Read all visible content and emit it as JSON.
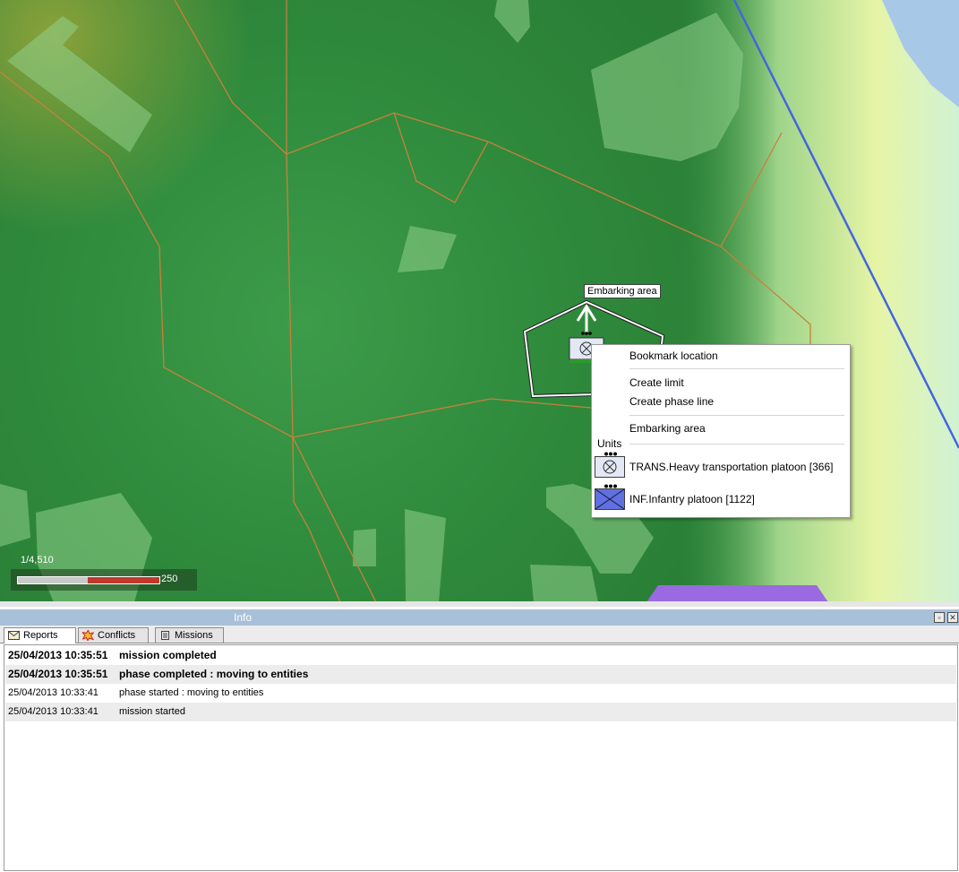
{
  "map": {
    "labels": {
      "embarking_area": "Embarking area"
    },
    "scale": {
      "ratio": "1/4,510",
      "value": "250"
    }
  },
  "context_menu": {
    "items": {
      "bookmark": "Bookmark location",
      "create_limit": "Create limit",
      "create_phase_line": "Create phase line",
      "embarking_area": "Embarking area"
    },
    "units_heading": "Units",
    "units": [
      {
        "label": "TRANS.Heavy transportation platoon [366]",
        "icon": "transport-unit-icon"
      },
      {
        "label": "INF.Infantry platoon [1122]",
        "icon": "infantry-unit-icon"
      }
    ]
  },
  "info_panel": {
    "title": "Info",
    "tabs": [
      {
        "label": "Reports",
        "icon": "envelope-icon"
      },
      {
        "label": "Conflicts",
        "icon": "explosion-icon"
      },
      {
        "label": "Missions",
        "icon": "list-icon"
      }
    ],
    "active_tab": "Reports",
    "rows": [
      {
        "time": "25/04/2013 10:35:51",
        "message": "mission completed",
        "bold": true
      },
      {
        "time": "25/04/2013 10:35:51",
        "message": "phase completed : moving to entities",
        "bold": true
      },
      {
        "time": "25/04/2013 10:33:41",
        "message": "phase started : moving to entities",
        "bold": false
      },
      {
        "time": "25/04/2013 10:33:41",
        "message": "mission started",
        "bold": false
      }
    ]
  },
  "colors": {
    "terrain_dark": "#2f8a3c",
    "terrain_light": "#e8f7a0",
    "water": "#a8c8e8",
    "boundary_lines": "#c8803c",
    "phase_line": "#4466dd",
    "friendly_unit": "#6070e0",
    "title_bar": "#a8c0d8"
  }
}
